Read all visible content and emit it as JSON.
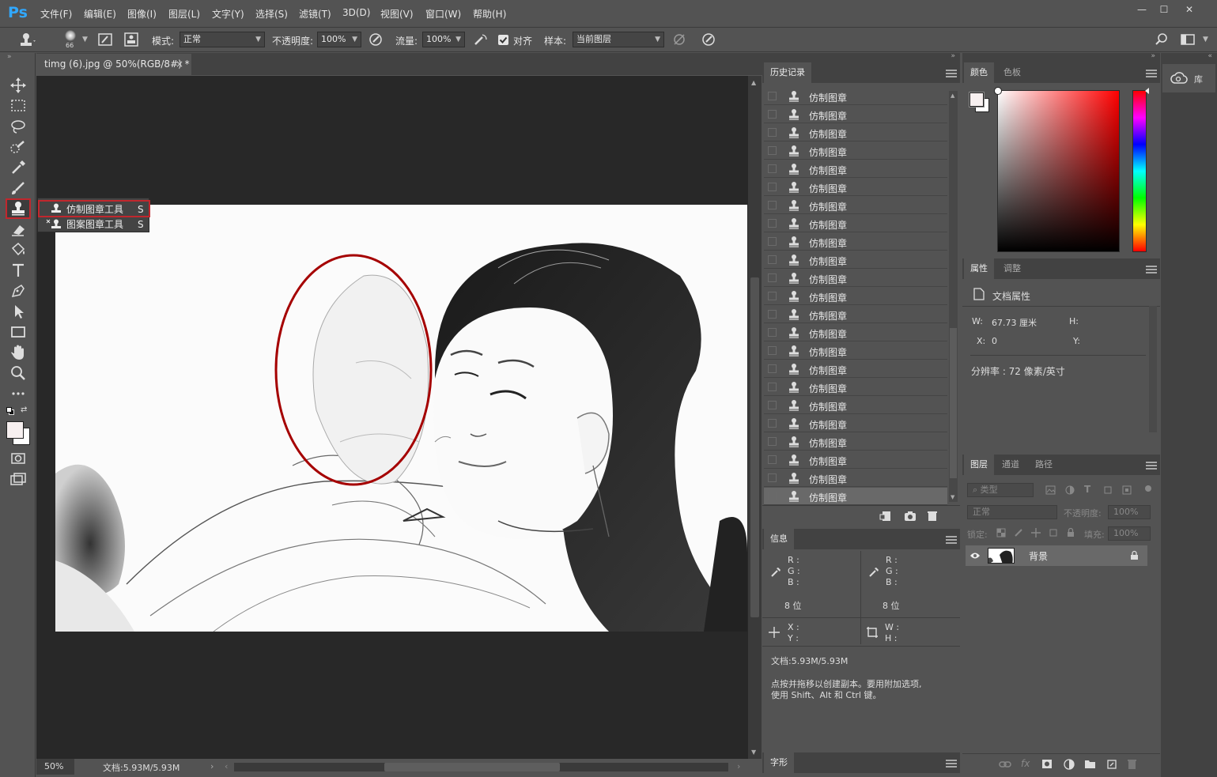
{
  "app": {
    "logo": "Ps"
  },
  "menu": {
    "items": [
      "文件(F)",
      "编辑(E)",
      "图像(I)",
      "图层(L)",
      "文字(Y)",
      "选择(S)",
      "滤镜(T)",
      "3D(D)",
      "视图(V)",
      "窗口(W)",
      "帮助(H)"
    ]
  },
  "window_controls": {
    "minimize": "—",
    "maximize": "☐",
    "close": "✕"
  },
  "options": {
    "brush_size": "66",
    "mode_label": "模式:",
    "mode_value": "正常",
    "opacity_label": "不透明度:",
    "opacity_value": "100%",
    "flow_label": "流量:",
    "flow_value": "100%",
    "aligned_label": "对齐",
    "aligned_checked": true,
    "sample_label": "样本:",
    "sample_value": "当前图层"
  },
  "document": {
    "tab_title": "timg (6).jpg @ 50%(RGB/8#) *",
    "tab_close": "×",
    "zoom": "50%",
    "doc_size": "文档:5.93M/5.93M"
  },
  "tool_flyout": {
    "items": [
      {
        "label": "仿制图章工具",
        "shortcut": "S",
        "active": true
      },
      {
        "label": "图案图章工具",
        "shortcut": "S",
        "active": false
      }
    ]
  },
  "history_panel": {
    "tab": "历史记录",
    "items": [
      "仿制图章",
      "仿制图章",
      "仿制图章",
      "仿制图章",
      "仿制图章",
      "仿制图章",
      "仿制图章",
      "仿制图章",
      "仿制图章",
      "仿制图章",
      "仿制图章",
      "仿制图章",
      "仿制图章",
      "仿制图章",
      "仿制图章",
      "仿制图章",
      "仿制图章",
      "仿制图章",
      "仿制图章",
      "仿制图章",
      "仿制图章",
      "仿制图章",
      "仿制图章"
    ]
  },
  "info_panel": {
    "tab": "信息",
    "r": "R :",
    "g": "G :",
    "b": "B :",
    "bits": "8 位",
    "x": "X :",
    "y": "Y :",
    "w": "W :",
    "h": "H :",
    "doc": "文档:5.93M/5.93M",
    "hint_line1": "点按并拖移以创建副本。要用附加选项,",
    "hint_line2": "使用 Shift、Alt 和 Ctrl 键。"
  },
  "glyph_panel": {
    "tab": "字形"
  },
  "color_panel": {
    "tabs": [
      "颜色",
      "色板"
    ],
    "hue_color": "#ff0000"
  },
  "properties_panel": {
    "tabs": [
      "属性",
      "调整"
    ],
    "title": "文档属性",
    "w_label": "W:",
    "w_value": "67.73 厘米",
    "h_label": "H:",
    "x_label": "X:",
    "x_value": "0",
    "y_label": "Y:",
    "resolution": "分辨率 : 72 像素/英寸"
  },
  "layers_panel": {
    "tabs": [
      "图层",
      "通道",
      "路径"
    ],
    "filter_placeholder": "类型",
    "blend": "正常",
    "opacity_label": "不透明度:",
    "opacity_value": "100%",
    "lock_label": "锁定:",
    "fill_label": "填充:",
    "fill_value": "100%",
    "layer_name": "背景"
  },
  "libraries": {
    "label": "库"
  }
}
